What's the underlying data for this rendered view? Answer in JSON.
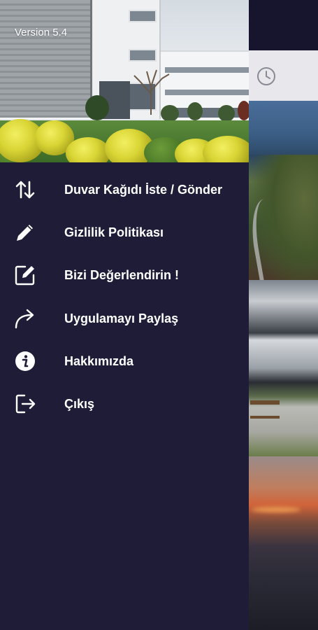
{
  "drawer": {
    "version_label": "Version 5.4",
    "header_image": "campus-building-photo",
    "background_color": "#1f1c37",
    "text_color": "#ffffff"
  },
  "menu": {
    "items": [
      {
        "label": "Duvar Kağıdı İste / Gönder",
        "icon": "swap-vertical-icon"
      },
      {
        "label": "Gizlilik Politikası",
        "icon": "pencil-icon"
      },
      {
        "label": "Bizi Değerlendirin !",
        "icon": "edit-square-icon"
      },
      {
        "label": "Uygulamayı Paylaş",
        "icon": "share-arrow-icon"
      },
      {
        "label": "Hakkımızda",
        "icon": "info-icon"
      },
      {
        "label": "Çıkış",
        "icon": "logout-icon"
      }
    ]
  },
  "background_app": {
    "visible_icon": "clock-icon"
  }
}
